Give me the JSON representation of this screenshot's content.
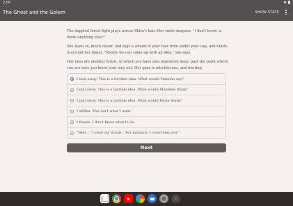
{
  "status_bar": {
    "time": "2:06"
  },
  "app_bar": {
    "title": "The Ghost and the Golem",
    "show_stats_label": "SHOW STATS"
  },
  "story": {
    "paragraphs": [
      "The dappled forest light plays across Shira's hair. Her smile deepens. \"I don't know, is there anything else?\"",
      "She leans in, much closer, and tugs a strand of your hair from under your cap, and twists it around her finger. \"Maybe we can come up with an idea,\" she says.",
      "Her eyes are another forest, in which you have also wandered deep, past the point where you are sure you know your way out. Her gaze is mischievous, and inviting."
    ]
  },
  "choices": [
    {
      "label": "I look away. This is a terrible idea. What would Mamma say?",
      "selected": true
    },
    {
      "label": "I pull away. This is a terrible idea. What would Moysheh think?",
      "selected": false
    },
    {
      "label": "I pull away. This is a terrible idea. What would Rivka think?",
      "selected": false
    },
    {
      "label": "I stiffen. This isn't what I want.",
      "selected": false
    },
    {
      "label": "I freeze. I don't know what to do.",
      "selected": false
    },
    {
      "label": "\"Well…\" I clear my throat. \"For instance, I could kiss you.\"",
      "selected": false
    }
  ],
  "next_button": {
    "label": "Next"
  },
  "colors": {
    "app_bar": "#525050",
    "background": "#f5f2ed",
    "radio_selected": "#3f6fd4",
    "next_button": "#5e5c5a"
  },
  "taskbar": {
    "apps": [
      {
        "name": "gmail-icon"
      },
      {
        "name": "chrome-icon"
      },
      {
        "name": "youtube-icon"
      },
      {
        "name": "photos-icon"
      },
      {
        "name": "messages-icon"
      },
      {
        "name": "files-icon"
      },
      {
        "name": "app-launcher-icon"
      }
    ]
  }
}
